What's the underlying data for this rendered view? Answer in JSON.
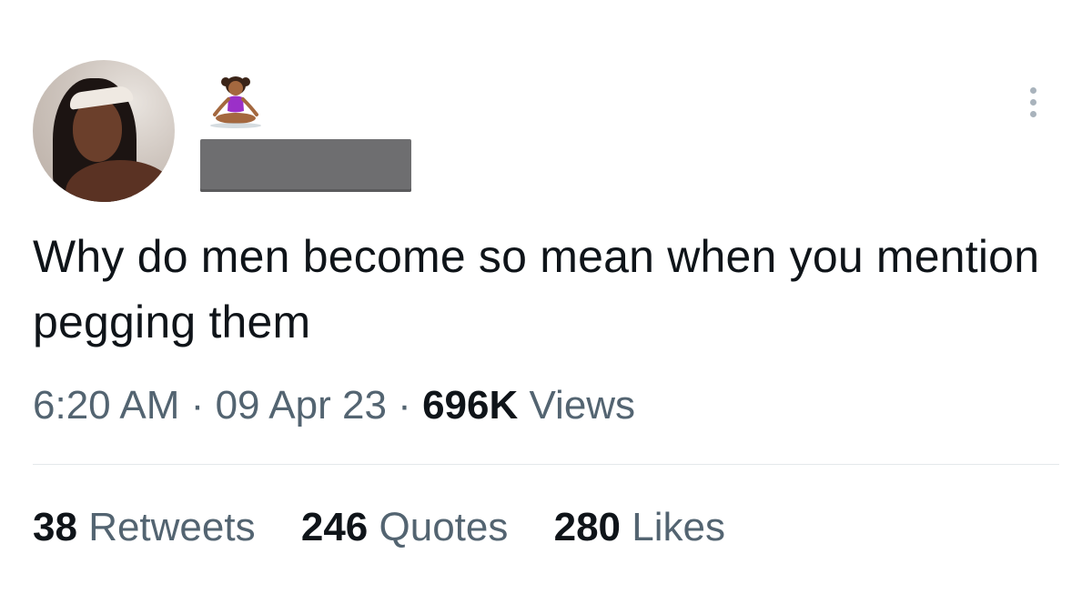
{
  "tweet": {
    "text": "Why do men become so mean when you mention pegging them",
    "time": "6:20 AM",
    "date": "09 Apr 23",
    "separator": "·",
    "views_count": "696K",
    "views_label": "Views"
  },
  "author": {
    "avatar_icon": "profile-photo",
    "name_emoji_icon": "person-in-lotus-position",
    "handle_redacted": true
  },
  "stats": {
    "retweets_count": "38",
    "retweets_label": "Retweets",
    "quotes_count": "246",
    "quotes_label": "Quotes",
    "likes_count": "280",
    "likes_label": "Likes"
  },
  "colors": {
    "text_primary": "#0f1419",
    "text_secondary": "#536471",
    "divider": "#e4e8eb",
    "redaction": "#6e6e70"
  }
}
